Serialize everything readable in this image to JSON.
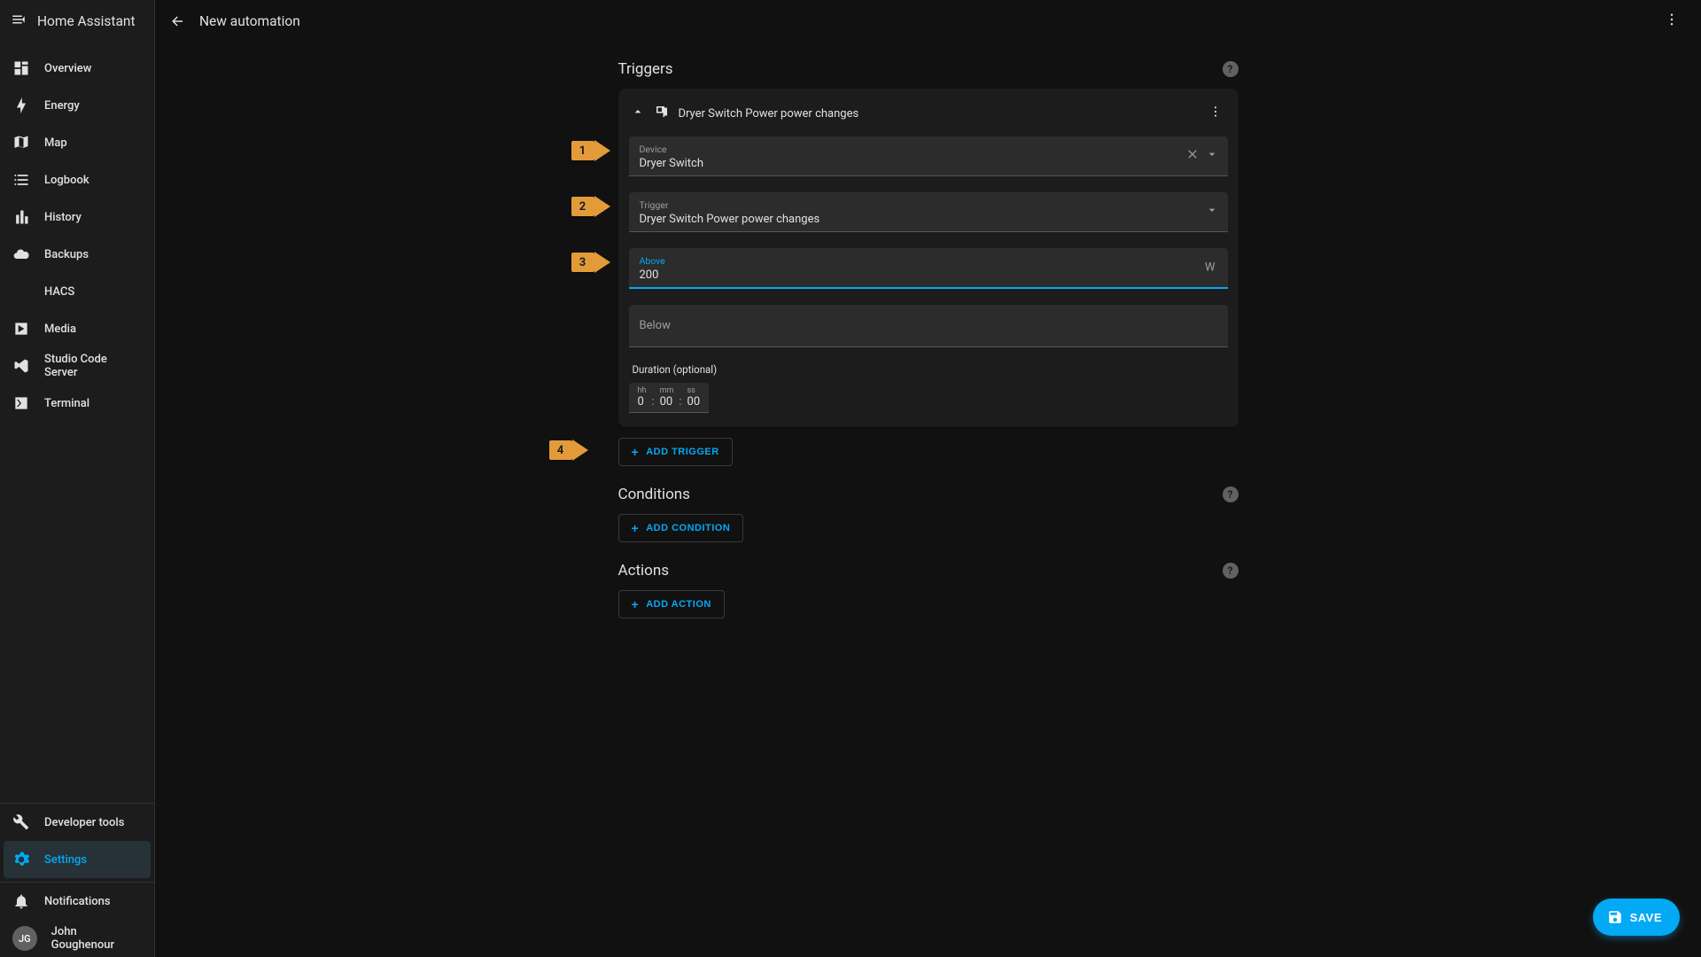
{
  "app_title": "Home Assistant",
  "page_title": "New automation",
  "sidebar": {
    "items": [
      {
        "label": "Overview"
      },
      {
        "label": "Energy"
      },
      {
        "label": "Map"
      },
      {
        "label": "Logbook"
      },
      {
        "label": "History"
      },
      {
        "label": "Backups"
      },
      {
        "label": "HACS"
      },
      {
        "label": "Media"
      },
      {
        "label": "Studio Code Server"
      },
      {
        "label": "Terminal"
      }
    ],
    "dev_tools": "Developer tools",
    "settings": "Settings",
    "notifications": "Notifications",
    "user_initials": "JG",
    "user_name": "John Goughenour"
  },
  "sections": {
    "triggers": "Triggers",
    "conditions": "Conditions",
    "actions": "Actions"
  },
  "trigger_card": {
    "title": "Dryer Switch Power power changes",
    "device_label": "Device",
    "device_value": "Dryer Switch",
    "trigger_label": "Trigger",
    "trigger_value": "Dryer Switch Power power changes",
    "above_label": "Above",
    "above_value": "200",
    "above_unit": "W",
    "below_label": "Below",
    "below_value": "",
    "duration_label": "Duration (optional)",
    "duration": {
      "hh_label": "hh",
      "hh": "0",
      "mm_label": "mm",
      "mm": "00",
      "ss_label": "ss",
      "ss": "00"
    }
  },
  "buttons": {
    "add_trigger": "ADD TRIGGER",
    "add_condition": "ADD CONDITION",
    "add_action": "ADD ACTION",
    "save": "SAVE"
  },
  "annotations": {
    "a1": "1",
    "a2": "2",
    "a3": "3",
    "a4": "4"
  }
}
